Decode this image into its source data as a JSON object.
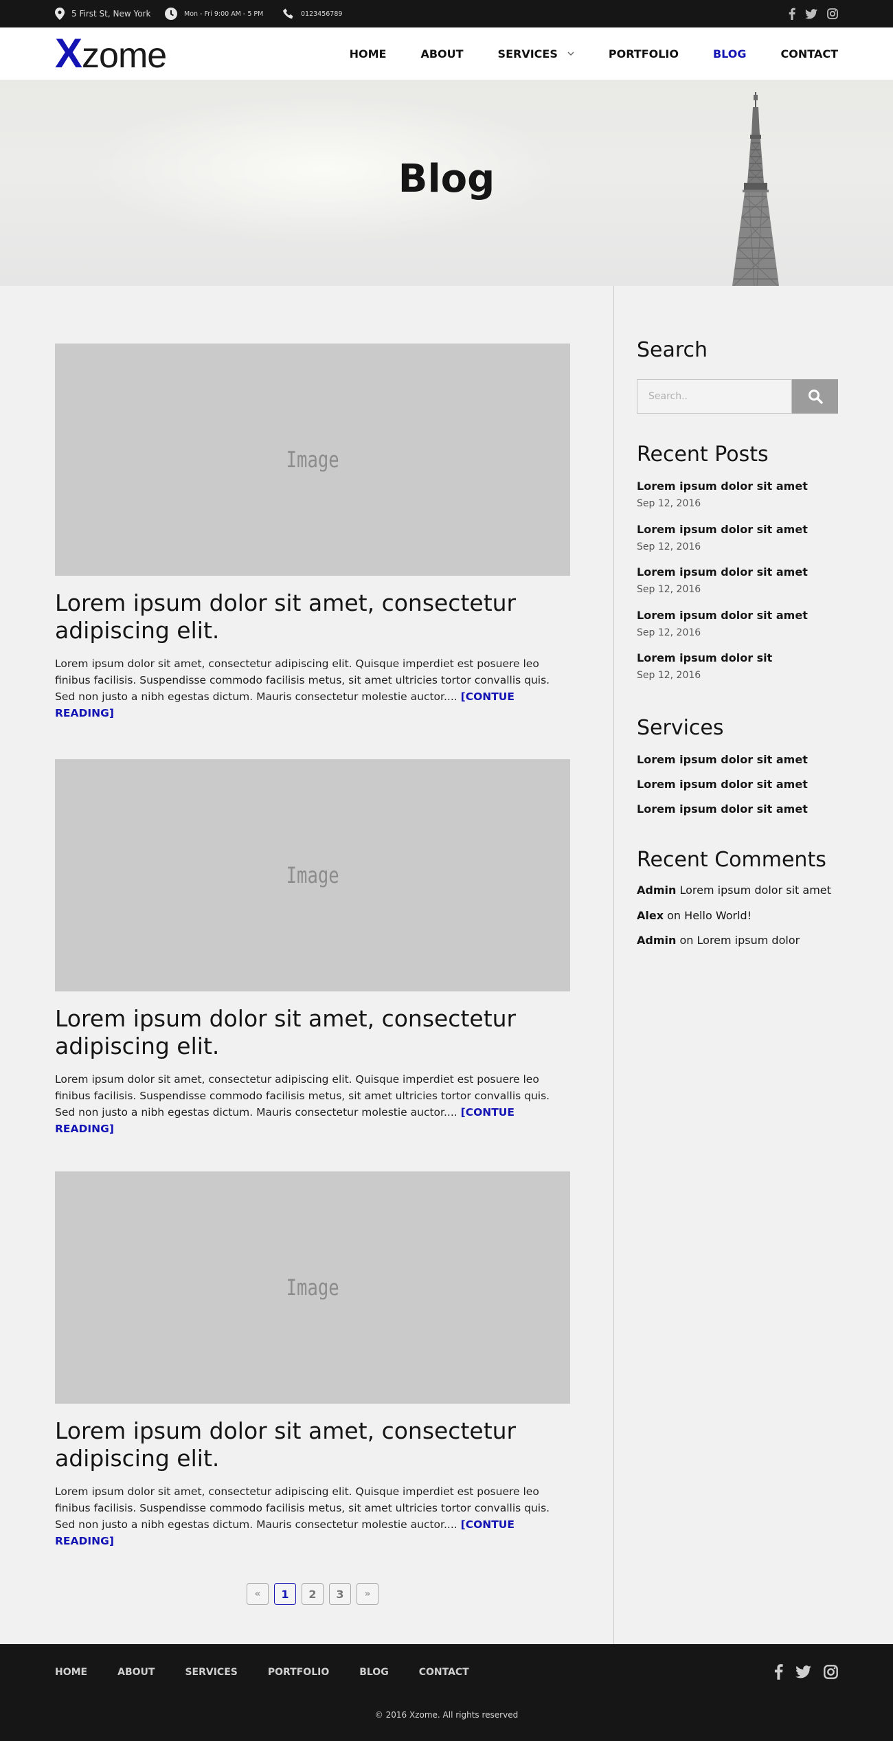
{
  "topbar": {
    "address": "5 First St, New York",
    "hours": "Mon - Fri 9:00 AM - 5 PM",
    "phone": "0123456789",
    "social_icons": [
      "facebook-icon",
      "twitter-icon",
      "instagram-icon"
    ]
  },
  "brand": {
    "logo_initial": "X",
    "logo_rest": "zome",
    "accent_color": "#1414b4"
  },
  "nav": {
    "items": [
      "HOME",
      "ABOUT",
      "SERVICES",
      "PORTFOLIO",
      "BLOG",
      "CONTACT"
    ],
    "active": "BLOG"
  },
  "hero": {
    "title": "Blog"
  },
  "posts": [
    {
      "image_label": "Image",
      "title": "Lorem ipsum dolor sit amet, consectetur adipiscing elit.",
      "excerpt": "Lorem ipsum dolor sit amet, consectetur adipiscing elit. Quisque imperdiet est posuere leo finibus facilisis. Suspendisse commodo facilisis metus, sit amet ultricies tortor convallis quis. Sed non justo a nibh egestas dictum. Mauris consectetur molestie auctor....",
      "more": "[CONTUE READING]"
    },
    {
      "image_label": "Image",
      "title": "Lorem ipsum dolor sit amet, consectetur adipiscing elit.",
      "excerpt": "Lorem ipsum dolor sit amet, consectetur adipiscing elit. Quisque imperdiet est posuere leo finibus facilisis. Suspendisse commodo facilisis metus, sit amet ultricies tortor convallis quis. Sed non justo a nibh egestas dictum. Mauris consectetur molestie auctor....",
      "more": "[CONTUE READING]"
    },
    {
      "image_label": "Image",
      "title": "Lorem ipsum dolor sit amet, consectetur adipiscing elit.",
      "excerpt": "Lorem ipsum dolor sit amet, consectetur adipiscing elit. Quisque imperdiet est posuere leo finibus facilisis. Suspendisse commodo facilisis metus, sit amet ultricies tortor convallis quis. Sed non justo a nibh egestas dictum. Mauris consectetur molestie auctor....",
      "more": "[CONTUE READING]"
    }
  ],
  "pagination": {
    "prev": "«",
    "pages": [
      "1",
      "2",
      "3"
    ],
    "current": "1",
    "next": "»"
  },
  "sidebar": {
    "search_title": "Search",
    "search_placeholder": "Search..",
    "recent_title": "Recent Posts",
    "recent_posts": [
      {
        "title": "Lorem ipsum dolor sit amet",
        "date": "Sep 12, 2016"
      },
      {
        "title": "Lorem ipsum dolor sit amet",
        "date": "Sep 12, 2016"
      },
      {
        "title": "Lorem ipsum dolor sit amet",
        "date": "Sep 12, 2016"
      },
      {
        "title": "Lorem ipsum dolor sit amet",
        "date": "Sep 12, 2016"
      },
      {
        "title": "Lorem ipsum dolor sit",
        "date": "Sep 12, 2016"
      }
    ],
    "services_title": "Services",
    "services": [
      "Lorem ipsum dolor sit amet",
      "Lorem ipsum dolor sit amet",
      "Lorem ipsum dolor sit amet"
    ],
    "comments_title": "Recent Comments",
    "comments": [
      {
        "author": "Admin",
        "joiner": "",
        "text": "Lorem ipsum dolor sit amet"
      },
      {
        "author": "Alex",
        "joiner": "on",
        "text": "Hello World!"
      },
      {
        "author": "Admin",
        "joiner": "on",
        "text": "Lorem ipsum dolor"
      }
    ]
  },
  "footer": {
    "nav": [
      "HOME",
      "ABOUT",
      "SERVICES",
      "PORTFOLIO",
      "BLOG",
      "CONTACT"
    ],
    "copyright": "© 2016 Xzome. All rights reserved"
  }
}
